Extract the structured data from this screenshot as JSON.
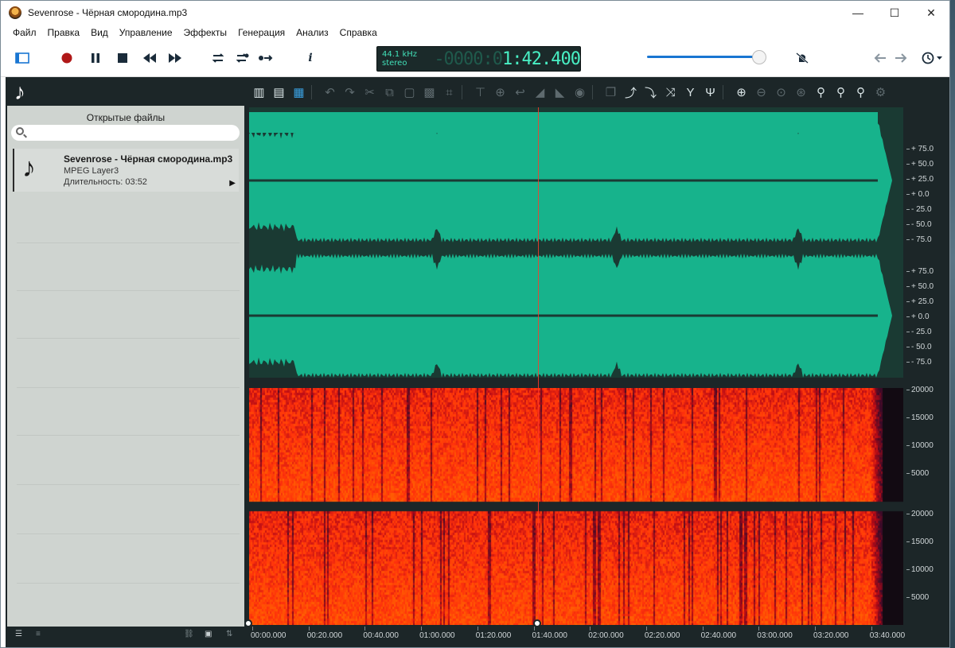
{
  "window": {
    "title": "Sevenrose - Чёрная смородина.mp3",
    "controls": {
      "minimize": "—",
      "maximize": "☐",
      "close": "✕"
    }
  },
  "menu": [
    "Файл",
    "Правка",
    "Вид",
    "Управление",
    "Эффекты",
    "Генерация",
    "Анализ",
    "Справка"
  ],
  "transport": {
    "sample_rate": "44.1 kHz",
    "channels": "stereo",
    "time_prefix": "-0000:0",
    "time": "1:42.400",
    "volume": 0.92,
    "icons": [
      "sidebar-icon",
      "record-icon",
      "pause-icon",
      "stop-icon",
      "rewind-icon",
      "fast-forward-icon",
      "loop-icon",
      "loop-selection-icon",
      "skip-icon",
      "info-icon",
      "no-effects-icon",
      "back-arrow-icon",
      "forward-arrow-icon",
      "history-icon"
    ]
  },
  "editor_toolbar": {
    "icons": [
      "waveform-view-icon",
      "spectrum-view-icon",
      "spectrogram-view-icon",
      "undo-icon",
      "redo-icon",
      "cut-icon",
      "copy-icon",
      "paste-icon",
      "delete-icon",
      "crop-icon",
      "align-top-icon",
      "align-center-icon",
      "reverse-icon",
      "fade-in-icon",
      "fade-out-icon",
      "normalize-icon",
      "copy-selection-icon",
      "curve-up-icon",
      "curve-down-icon",
      "shuffle-icon",
      "split-icon",
      "merge-icon",
      "zoom-in-icon",
      "zoom-out-icon",
      "zoom-fit-icon",
      "zoom-selection-icon",
      "marker-add-icon",
      "marker-remove-icon",
      "marker-link-icon",
      "settings-icon"
    ]
  },
  "open_files": {
    "title": "Открытые файлы",
    "search_placeholder": "",
    "items": [
      {
        "name": "Sevenrose - Чёрная смородина.mp3",
        "format": "MPEG Layer3",
        "duration": "Длительность: 03:52"
      }
    ]
  },
  "scales": {
    "amplitude_ch1": [
      "75.0",
      "50.0",
      "25.0",
      "0.0",
      "25.0",
      "50.0",
      "75.0"
    ],
    "amplitude_ch2": [
      "75.0",
      "50.0",
      "25.0",
      "0.0",
      "25.0",
      "50.0",
      "75.0"
    ],
    "freq_ch1": [
      "20000",
      "15000",
      "10000",
      "5000"
    ],
    "freq_ch2": [
      "20000",
      "15000",
      "10000",
      "5000"
    ]
  },
  "timeline": {
    "labels": [
      "00:00.000",
      "00:20.000",
      "00:40.000",
      "01:00.000",
      "01:20.000",
      "01:40.000",
      "02:00.000",
      "02:20.000",
      "02:40.000",
      "03:00.000",
      "03:20.000",
      "03:40.000"
    ],
    "cursor_time": "01:42.400"
  },
  "colors": {
    "waveform": "#17b38c",
    "waveform_bg": "#1a3a33",
    "cursor": "#ff3a2a",
    "accent": "#1976d2",
    "spectrogram_hot": "#ff6a1e",
    "spectrogram_cold": "#3a0a3a"
  }
}
